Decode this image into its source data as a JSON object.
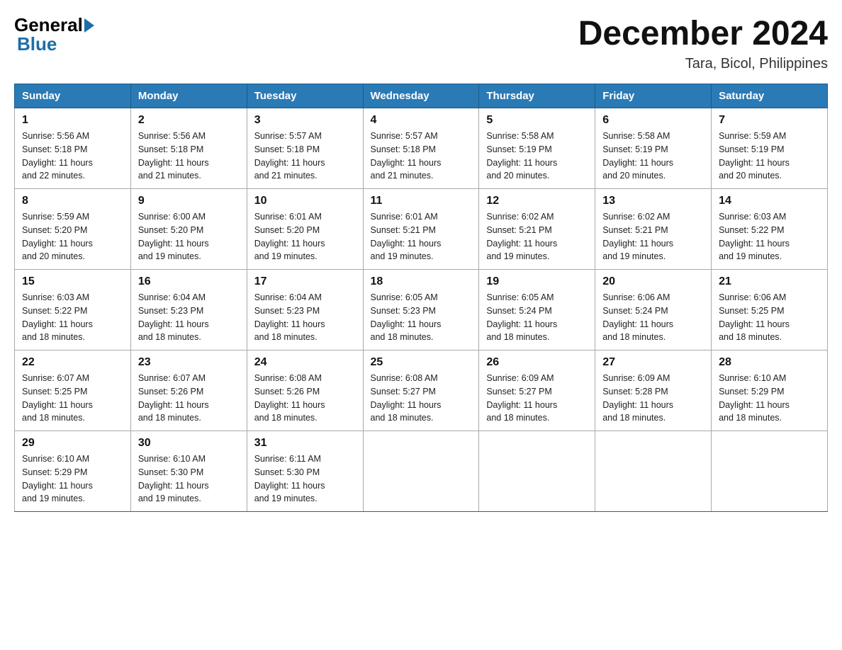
{
  "header": {
    "logo_general": "General",
    "logo_blue": "Blue",
    "month_title": "December 2024",
    "location": "Tara, Bicol, Philippines"
  },
  "weekdays": [
    "Sunday",
    "Monday",
    "Tuesday",
    "Wednesday",
    "Thursday",
    "Friday",
    "Saturday"
  ],
  "weeks": [
    [
      {
        "day": "1",
        "sunrise": "5:56 AM",
        "sunset": "5:18 PM",
        "daylight": "11 hours and 22 minutes."
      },
      {
        "day": "2",
        "sunrise": "5:56 AM",
        "sunset": "5:18 PM",
        "daylight": "11 hours and 21 minutes."
      },
      {
        "day": "3",
        "sunrise": "5:57 AM",
        "sunset": "5:18 PM",
        "daylight": "11 hours and 21 minutes."
      },
      {
        "day": "4",
        "sunrise": "5:57 AM",
        "sunset": "5:18 PM",
        "daylight": "11 hours and 21 minutes."
      },
      {
        "day": "5",
        "sunrise": "5:58 AM",
        "sunset": "5:19 PM",
        "daylight": "11 hours and 20 minutes."
      },
      {
        "day": "6",
        "sunrise": "5:58 AM",
        "sunset": "5:19 PM",
        "daylight": "11 hours and 20 minutes."
      },
      {
        "day": "7",
        "sunrise": "5:59 AM",
        "sunset": "5:19 PM",
        "daylight": "11 hours and 20 minutes."
      }
    ],
    [
      {
        "day": "8",
        "sunrise": "5:59 AM",
        "sunset": "5:20 PM",
        "daylight": "11 hours and 20 minutes."
      },
      {
        "day": "9",
        "sunrise": "6:00 AM",
        "sunset": "5:20 PM",
        "daylight": "11 hours and 19 minutes."
      },
      {
        "day": "10",
        "sunrise": "6:01 AM",
        "sunset": "5:20 PM",
        "daylight": "11 hours and 19 minutes."
      },
      {
        "day": "11",
        "sunrise": "6:01 AM",
        "sunset": "5:21 PM",
        "daylight": "11 hours and 19 minutes."
      },
      {
        "day": "12",
        "sunrise": "6:02 AM",
        "sunset": "5:21 PM",
        "daylight": "11 hours and 19 minutes."
      },
      {
        "day": "13",
        "sunrise": "6:02 AM",
        "sunset": "5:21 PM",
        "daylight": "11 hours and 19 minutes."
      },
      {
        "day": "14",
        "sunrise": "6:03 AM",
        "sunset": "5:22 PM",
        "daylight": "11 hours and 19 minutes."
      }
    ],
    [
      {
        "day": "15",
        "sunrise": "6:03 AM",
        "sunset": "5:22 PM",
        "daylight": "11 hours and 18 minutes."
      },
      {
        "day": "16",
        "sunrise": "6:04 AM",
        "sunset": "5:23 PM",
        "daylight": "11 hours and 18 minutes."
      },
      {
        "day": "17",
        "sunrise": "6:04 AM",
        "sunset": "5:23 PM",
        "daylight": "11 hours and 18 minutes."
      },
      {
        "day": "18",
        "sunrise": "6:05 AM",
        "sunset": "5:23 PM",
        "daylight": "11 hours and 18 minutes."
      },
      {
        "day": "19",
        "sunrise": "6:05 AM",
        "sunset": "5:24 PM",
        "daylight": "11 hours and 18 minutes."
      },
      {
        "day": "20",
        "sunrise": "6:06 AM",
        "sunset": "5:24 PM",
        "daylight": "11 hours and 18 minutes."
      },
      {
        "day": "21",
        "sunrise": "6:06 AM",
        "sunset": "5:25 PM",
        "daylight": "11 hours and 18 minutes."
      }
    ],
    [
      {
        "day": "22",
        "sunrise": "6:07 AM",
        "sunset": "5:25 PM",
        "daylight": "11 hours and 18 minutes."
      },
      {
        "day": "23",
        "sunrise": "6:07 AM",
        "sunset": "5:26 PM",
        "daylight": "11 hours and 18 minutes."
      },
      {
        "day": "24",
        "sunrise": "6:08 AM",
        "sunset": "5:26 PM",
        "daylight": "11 hours and 18 minutes."
      },
      {
        "day": "25",
        "sunrise": "6:08 AM",
        "sunset": "5:27 PM",
        "daylight": "11 hours and 18 minutes."
      },
      {
        "day": "26",
        "sunrise": "6:09 AM",
        "sunset": "5:27 PM",
        "daylight": "11 hours and 18 minutes."
      },
      {
        "day": "27",
        "sunrise": "6:09 AM",
        "sunset": "5:28 PM",
        "daylight": "11 hours and 18 minutes."
      },
      {
        "day": "28",
        "sunrise": "6:10 AM",
        "sunset": "5:29 PM",
        "daylight": "11 hours and 18 minutes."
      }
    ],
    [
      {
        "day": "29",
        "sunrise": "6:10 AM",
        "sunset": "5:29 PM",
        "daylight": "11 hours and 19 minutes."
      },
      {
        "day": "30",
        "sunrise": "6:10 AM",
        "sunset": "5:30 PM",
        "daylight": "11 hours and 19 minutes."
      },
      {
        "day": "31",
        "sunrise": "6:11 AM",
        "sunset": "5:30 PM",
        "daylight": "11 hours and 19 minutes."
      },
      null,
      null,
      null,
      null
    ]
  ],
  "labels": {
    "sunrise": "Sunrise:",
    "sunset": "Sunset:",
    "daylight": "Daylight:"
  }
}
